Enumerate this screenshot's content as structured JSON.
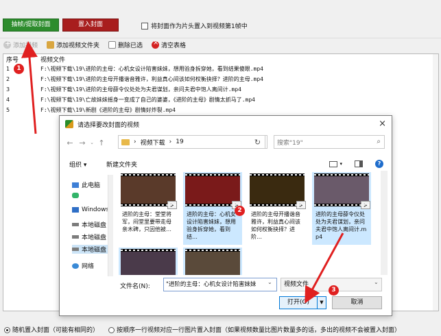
{
  "topbar": {
    "extract_button": "抽帧/提取封面",
    "insert_button": "置入封面",
    "first_frame_checkbox": "将封面作为片头置入到视频第1帧中"
  },
  "toolbar": {
    "add_video": "添加视频",
    "add_folder": "添加视频文件夹",
    "delete_selected": "删除已选",
    "clear_table": "清空表格"
  },
  "table": {
    "headers": {
      "no": "序号",
      "file": "视频文件"
    },
    "rows": [
      {
        "no": "1",
        "path": "F:\\视频下载\\19\\进阶的主母：心机女设计陷害妹妹，想用验身拆穿她，看到结果傻眼.mp4"
      },
      {
        "no": "2",
        "path": "F:\\视频下载\\19\\进阶的主母开播谐音雅许，利益真心间该如何权衡抉择？进阶的主母.mp4"
      },
      {
        "no": "3",
        "path": "F:\\视频下载\\19\\进阶的主母薛令仪处处为夫君谋划，亲问夫君中饱人离间计.mp4"
      },
      {
        "no": "4",
        "path": "F:\\视频下载\\19\\亡故妹妹摇身一变成了自己的婆婆，《进阶的主母》剧情太抓马了.mp4"
      },
      {
        "no": "5",
        "path": "F:\\视频下载\\19\\新剧《进阶的主母》剧情好炸裂.mp4"
      }
    ]
  },
  "bottom": {
    "option_random": "随机置入封面（可能有相同的）",
    "option_sequential": "按顺序一行视频对应一行图片置入封面（如果视频数量比图片数量多的话，多出的视频不会被置入封面）"
  },
  "dialog": {
    "title": "请选择要改封面的视频",
    "close": "×",
    "breadcrumb": [
      "视频下载",
      "19"
    ],
    "search_placeholder": "搜索\"19\"",
    "organize": "组织 ▾",
    "new_folder": "新建文件夹",
    "nav_items": [
      "此电脑",
      "",
      "Windows",
      "本地磁盘",
      "本地磁盘",
      "本地磁盘",
      "网络"
    ],
    "tiles": [
      {
        "label": "进阶的主母：堂堂将军，闷堂里要带走母亲木碑，只因他被…",
        "selected": false,
        "color": "#5a3a2a"
      },
      {
        "label": "进阶的主母：心机女设计陷害妹妹，想用验身拆穿她，看到结…",
        "selected": true,
        "color": "#7a1a1a"
      },
      {
        "label": "进阶的主母开播谐音雅许，利益真心间该如何权衡抉择？进阶…",
        "selected": false,
        "color": "#3a2a10"
      },
      {
        "label": "进阶的主母薛令仪处处为夫君谋划，亲问夫君中饱人离间计.mp4",
        "selected": true,
        "color": "#6a5a6a"
      },
      {
        "label": "",
        "selected": true,
        "color": "#4a3a4a"
      },
      {
        "label": "",
        "selected": true,
        "color": "#5a4a3a"
      }
    ],
    "filename_label": "文件名(N):",
    "filename_value": "\"进阶的主母：心机女设计陷害妹妹",
    "filetype_value": "视频文件",
    "open_button": "打开(O)",
    "cancel_button": "取消"
  },
  "markers": [
    "1",
    "2",
    "3"
  ],
  "colors": {
    "green_button": "#2d8c2d",
    "red_button": "#a81e1e",
    "marker": "#e02020",
    "selection": "#cce8ff",
    "accent": "#0078d7"
  }
}
